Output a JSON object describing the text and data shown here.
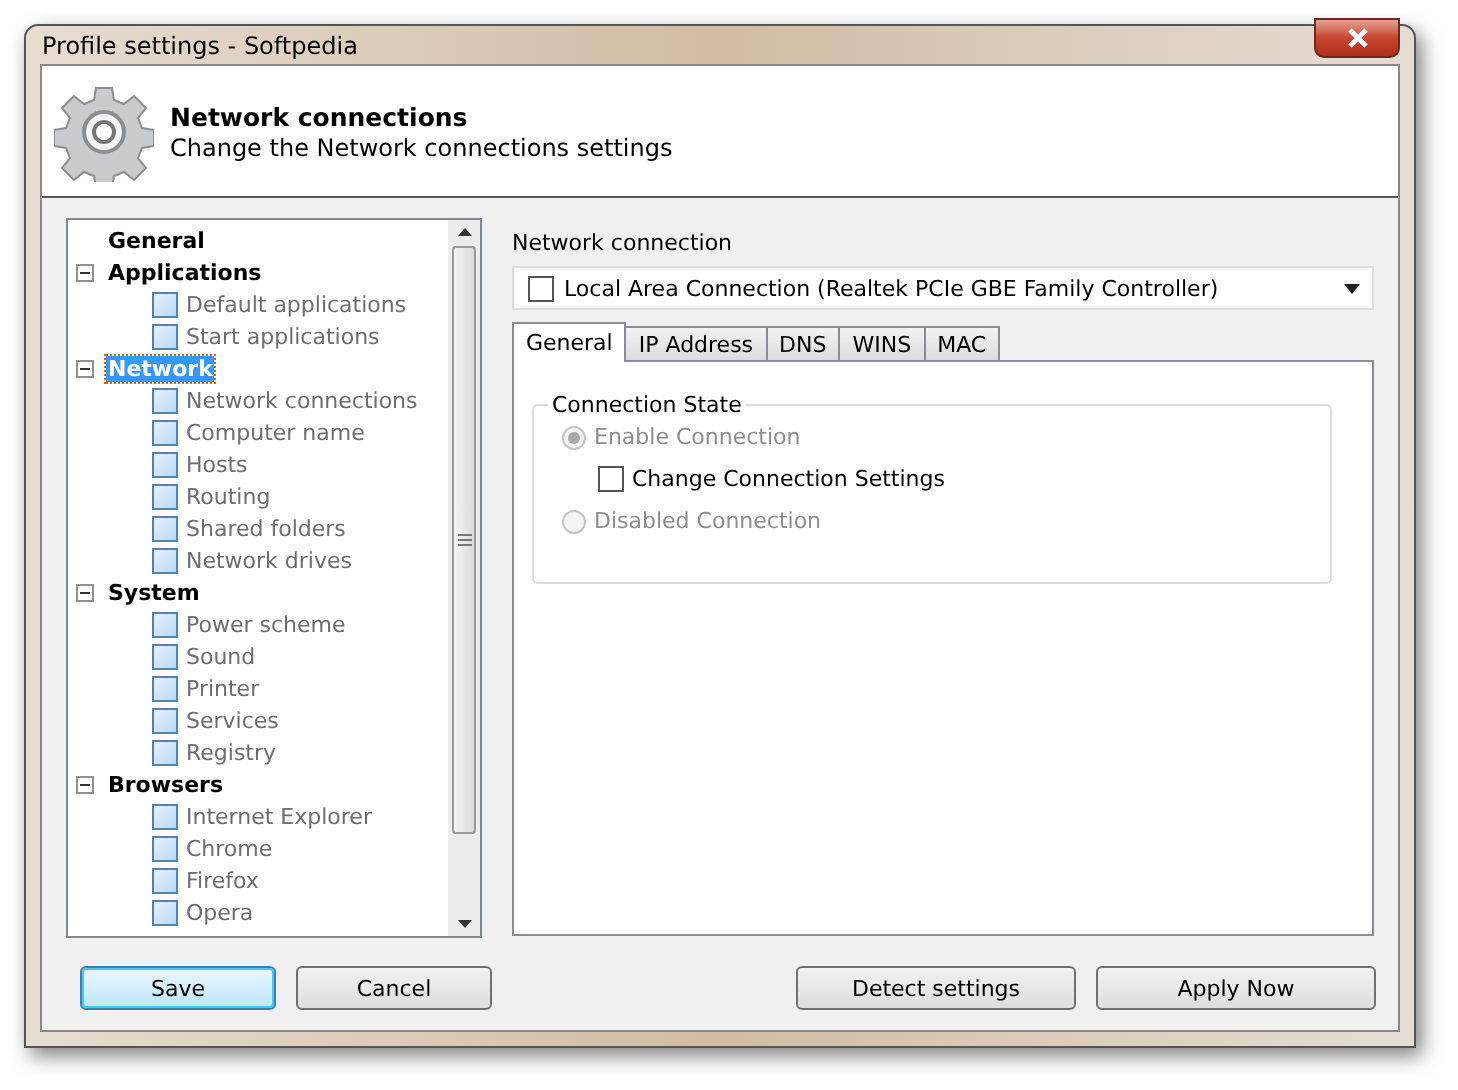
{
  "window": {
    "title": "Profile settings - Softpedia"
  },
  "header": {
    "title": "Network connections",
    "subtitle": "Change the Network connections settings"
  },
  "tree": [
    {
      "label": "General",
      "selected": false
    },
    {
      "label": "Applications",
      "selected": false,
      "expanded": true,
      "children": [
        {
          "label": "Default applications",
          "checked": false
        },
        {
          "label": "Start applications",
          "checked": false
        }
      ]
    },
    {
      "label": "Network",
      "selected": true,
      "expanded": true,
      "children": [
        {
          "label": "Network connections",
          "checked": false
        },
        {
          "label": "Computer name",
          "checked": false
        },
        {
          "label": "Hosts",
          "checked": false
        },
        {
          "label": "Routing",
          "checked": false
        },
        {
          "label": "Shared folders",
          "checked": false
        },
        {
          "label": "Network drives",
          "checked": false
        }
      ]
    },
    {
      "label": "System",
      "selected": false,
      "expanded": true,
      "children": [
        {
          "label": "Power scheme",
          "checked": false
        },
        {
          "label": "Sound",
          "checked": false
        },
        {
          "label": "Printer",
          "checked": false
        },
        {
          "label": "Services",
          "checked": false
        },
        {
          "label": "Registry",
          "checked": false
        }
      ]
    },
    {
      "label": "Browsers",
      "selected": false,
      "expanded": true,
      "children": [
        {
          "label": "Internet Explorer",
          "checked": false
        },
        {
          "label": "Chrome",
          "checked": false
        },
        {
          "label": "Firefox",
          "checked": false
        },
        {
          "label": "Opera",
          "checked": false
        }
      ]
    }
  ],
  "connection": {
    "label": "Network connection",
    "value": "Local Area Connection (Realtek PCIe GBE Family Controller)",
    "checked": false
  },
  "tabs": [
    {
      "label": "General",
      "selected": true
    },
    {
      "label": "IP Address",
      "selected": false
    },
    {
      "label": "DNS",
      "selected": false
    },
    {
      "label": "WINS",
      "selected": false
    },
    {
      "label": "MAC",
      "selected": false
    }
  ],
  "group": {
    "title": "Connection State",
    "options": [
      {
        "kind": "radio",
        "label": "Enable Connection",
        "selected": true,
        "disabled": true
      },
      {
        "kind": "checkbox",
        "label": "Change Connection Settings",
        "checked": false,
        "disabled": false
      },
      {
        "kind": "radio",
        "label": "Disabled Connection",
        "selected": false,
        "disabled": true
      }
    ]
  },
  "buttons": [
    {
      "label": "Save",
      "kind": "default"
    },
    {
      "label": "Cancel",
      "kind": "normal"
    },
    {
      "label": "Detect settings",
      "kind": "normal"
    },
    {
      "label": "Apply Now",
      "kind": "normal"
    }
  ]
}
